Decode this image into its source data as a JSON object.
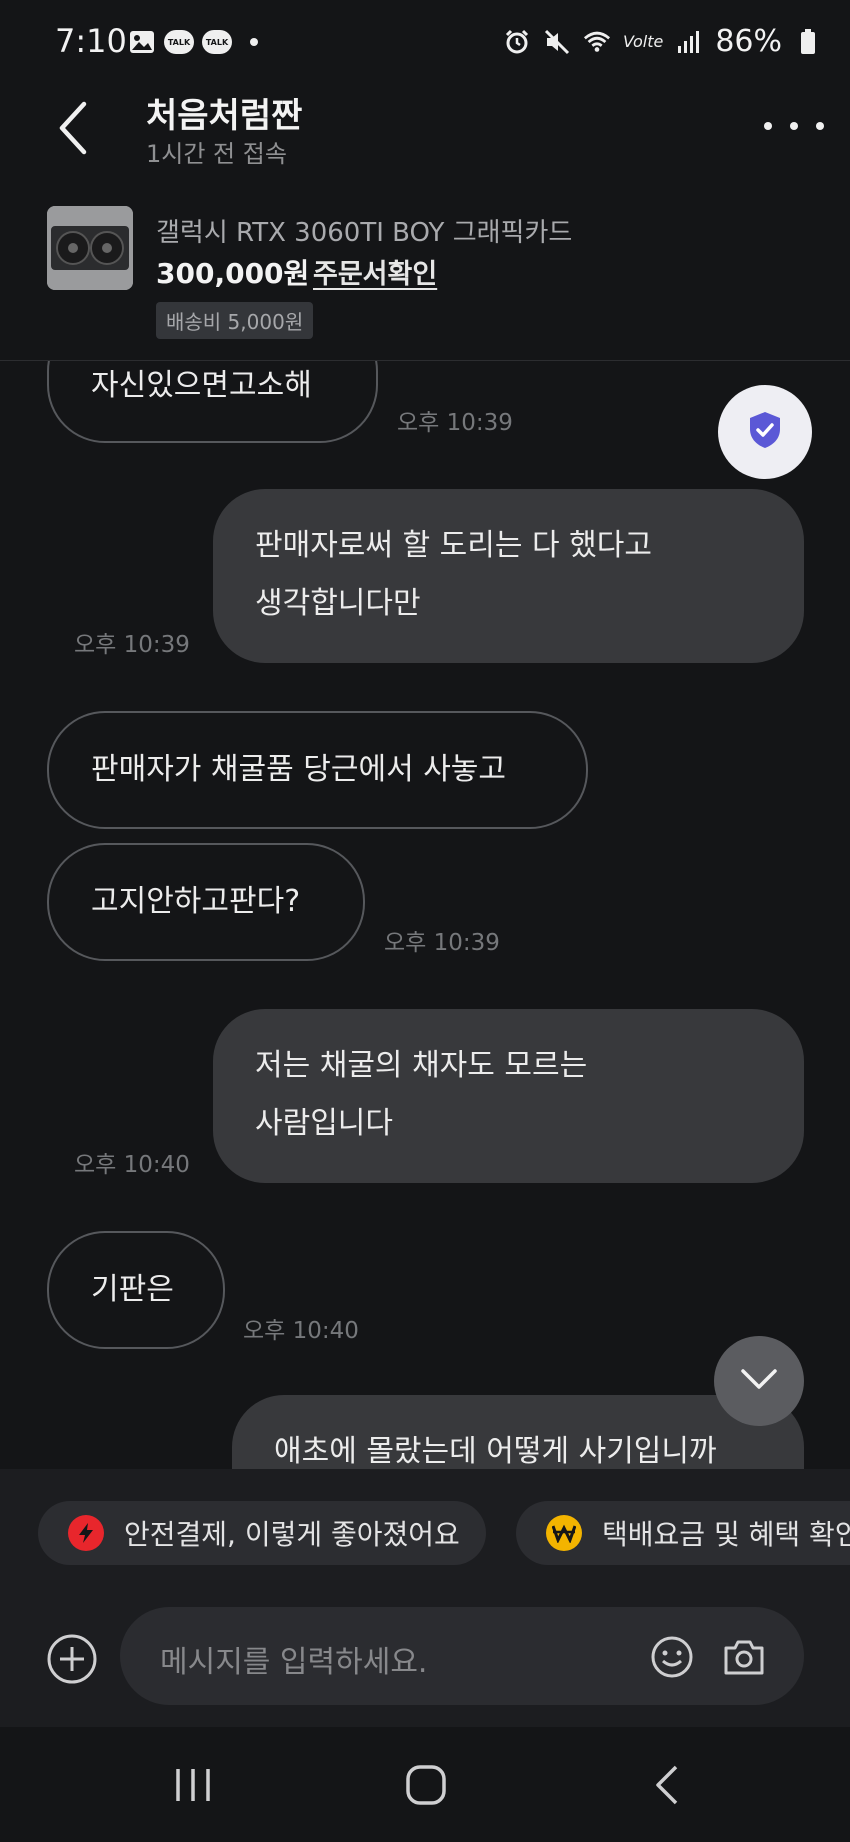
{
  "status_bar": {
    "time": "7:10",
    "battery": "86%",
    "talk_label": "TALK",
    "volte": "Volte",
    "icons_left": [
      "gallery-icon",
      "talk-icon",
      "talk-icon",
      "dot-icon"
    ],
    "icons_right": [
      "alarm-icon",
      "mute-icon",
      "wifi-icon",
      "volte-icon",
      "signal-icon",
      "battery-icon"
    ]
  },
  "header": {
    "title": "처음처럼짠",
    "subtitle": "1시간 전 접속"
  },
  "product": {
    "name": "갤럭시 RTX 3060TI BOY 그래픽카드",
    "price": "300,000원",
    "order_link": "주문서확인",
    "shipping": "배송비 5,000원"
  },
  "messages": [
    {
      "dir": "in",
      "text": "자신있으면고소해",
      "time": "오후 10:39"
    },
    {
      "dir": "out",
      "text": "판매자로써 할 도리는 다 했다고 생각합니다만",
      "line1": "판매자로써 할 도리는 다 했다고",
      "line2": "생각합니다만",
      "time": "오후 10:39"
    },
    {
      "dir": "in",
      "text": "판매자가 채굴품 당근에서 사놓고"
    },
    {
      "dir": "in",
      "text": "고지안하고판다?",
      "time": "오후 10:39"
    },
    {
      "dir": "out",
      "text": "저는 채굴의 채자도 모르는 사람입니다",
      "line1": "저는 채굴의 채자도 모르는",
      "line2": "사람입니다",
      "time": "오후 10:40"
    },
    {
      "dir": "in",
      "text": "기판은",
      "time": "오후 10:40"
    },
    {
      "dir": "out",
      "text": "애초에 몰랐는데 어떻게 사기입니까"
    }
  ],
  "quick_actions": [
    {
      "label": "안전결제, 이렇게 좋아졌어요",
      "icon": "lightning-icon",
      "color": "#e8262c"
    },
    {
      "label": "택배요금 및 혜택 확인",
      "icon": "won-icon",
      "color": "#f3b400"
    }
  ],
  "input": {
    "placeholder": "메시지를 입력하세요."
  },
  "colors": {
    "background": "#141517",
    "out_bubble": "#38393c",
    "in_bubble_border": "#56585c",
    "shield": "#5b58d6"
  }
}
